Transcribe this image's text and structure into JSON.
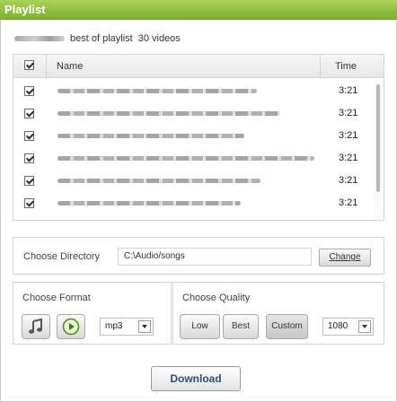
{
  "window": {
    "title": "Playlist"
  },
  "summary": {
    "playlist_name": "best of playlist",
    "count_label": "30 videos"
  },
  "table": {
    "columns": {
      "name": "Name",
      "time": "Time"
    },
    "header_checked": true,
    "rows": [
      {
        "checked": true,
        "time": "3:21"
      },
      {
        "checked": true,
        "time": "3:21"
      },
      {
        "checked": true,
        "time": "3:21"
      },
      {
        "checked": true,
        "time": "3:21"
      },
      {
        "checked": true,
        "time": "3:21"
      },
      {
        "checked": true,
        "time": "3:21"
      }
    ]
  },
  "directory": {
    "label": "Choose Directory",
    "path": "C:\\Audio/songs",
    "change_label": "Change"
  },
  "format": {
    "label": "Choose Format",
    "audio_icon": "music-note-icon",
    "video_icon": "play-circle-icon",
    "selected": "mp3"
  },
  "quality": {
    "label": "Choose Quality",
    "buttons": {
      "low": "Low",
      "best": "Best",
      "custom": "Custom"
    },
    "active": "Custom",
    "resolution": "1080"
  },
  "actions": {
    "download_label": "Download"
  },
  "colors": {
    "title_bar": "#8dbf3c",
    "download_text": "#2d4d7c"
  }
}
